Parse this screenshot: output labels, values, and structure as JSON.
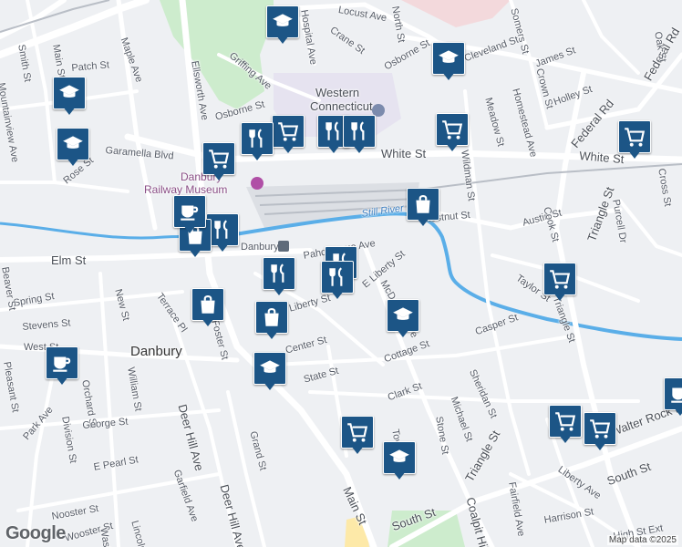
{
  "streets": [
    "Locust Ave",
    "Hospital Ave",
    "Crane St",
    "Osborne St",
    "Griffing Ave",
    "Ellsworth Ave",
    "Maple Ave",
    "Smith St",
    "Main St",
    "Patch St",
    "Osborne St",
    "Garamella Blvd",
    "Rose St",
    "White St",
    "White St",
    "Cleveland St",
    "James St",
    "Somers St",
    "Crown St",
    "Homestead Ave",
    "Meadow St",
    "Holley St",
    "Federal Rd",
    "Federal Rd",
    "Chestnut St",
    "Austin St",
    "Cook St",
    "Triangle St",
    "Purcell Dr",
    "Cross St",
    "Wildman St",
    "Elm St",
    "Pahquioque Ave",
    "E Liberty St",
    "Liberty St",
    "Spring St",
    "Stevens St",
    "New St",
    "Terrace Pl",
    "Center St",
    "McDonald Ave",
    "Casper St",
    "Taylor St",
    "Cottage St",
    "Foster St",
    "State St",
    "Clark St",
    "Sheridan St",
    "Michael St",
    "Stone St",
    "William St",
    "Orchard St",
    "George St",
    "Park Ave",
    "Division St",
    "Deer Hill Ave",
    "Deer Hill Ave",
    "Grand St",
    "Tower Ave",
    "Triangle St",
    "Main St",
    "South St",
    "South St",
    "Coalpit Hill Rd",
    "Fairfield Ave",
    "Liberty Ave",
    "Harrison St",
    "High St Ext",
    "Walter Rock Rd",
    "E Pearl St",
    "Garfield Ave",
    "Wooster St",
    "Wash",
    "Lincoln",
    "Beaver St",
    "Pleasant St",
    "Nooster St",
    "Triangle St",
    "North St",
    "Mountainview Ave",
    "West St",
    "Oak St"
  ],
  "places": {
    "danbury": "Danbury",
    "western": "Western",
    "connecticut": "Connecticut",
    "railway_line1": "Danbury",
    "railway_line2": "Railway Museum",
    "station": "Danbury",
    "river": "Still River"
  },
  "pins": [
    {
      "icon": "school-icon",
      "label": "school"
    },
    {
      "icon": "school-icon",
      "label": "school"
    },
    {
      "icon": "school-icon",
      "label": "school"
    },
    {
      "icon": "school-icon",
      "label": "school"
    },
    {
      "icon": "school-icon",
      "label": "school"
    },
    {
      "icon": "school-icon",
      "label": "school"
    },
    {
      "icon": "school-icon",
      "label": "school"
    },
    {
      "icon": "grocery-cart-icon",
      "label": "grocery"
    },
    {
      "icon": "grocery-cart-icon",
      "label": "grocery"
    },
    {
      "icon": "grocery-cart-icon",
      "label": "grocery"
    },
    {
      "icon": "grocery-cart-icon",
      "label": "grocery"
    },
    {
      "icon": "grocery-cart-icon",
      "label": "grocery"
    },
    {
      "icon": "grocery-cart-icon",
      "label": "grocery"
    },
    {
      "icon": "grocery-cart-icon",
      "label": "grocery"
    },
    {
      "icon": "grocery-cart-icon",
      "label": "grocery"
    },
    {
      "icon": "restaurant-icon",
      "label": "restaurant"
    },
    {
      "icon": "restaurant-icon",
      "label": "restaurant"
    },
    {
      "icon": "restaurant-icon",
      "label": "restaurant"
    },
    {
      "icon": "restaurant-icon",
      "label": "restaurant"
    },
    {
      "icon": "restaurant-icon",
      "label": "restaurant"
    },
    {
      "icon": "restaurant-icon",
      "label": "restaurant"
    },
    {
      "icon": "restaurant-icon",
      "label": "restaurant"
    },
    {
      "icon": "shopping-bag-icon",
      "label": "shopping"
    },
    {
      "icon": "shopping-bag-icon",
      "label": "shopping"
    },
    {
      "icon": "shopping-bag-icon",
      "label": "shopping"
    },
    {
      "icon": "shopping-bag-icon",
      "label": "shopping"
    },
    {
      "icon": "coffee-cup-icon",
      "label": "cafe"
    },
    {
      "icon": "coffee-cup-icon",
      "label": "cafe"
    },
    {
      "icon": "coffee-cup-icon",
      "label": "cafe"
    }
  ],
  "footer": {
    "logo": "Google",
    "attribution": "Map data ©2025"
  },
  "colors": {
    "pin": "#1c5586",
    "water": "#5aaee8",
    "park": "#cdeccd",
    "campus": "#e6e3f0",
    "road": "#ffffff",
    "land": "#eef0f3"
  }
}
